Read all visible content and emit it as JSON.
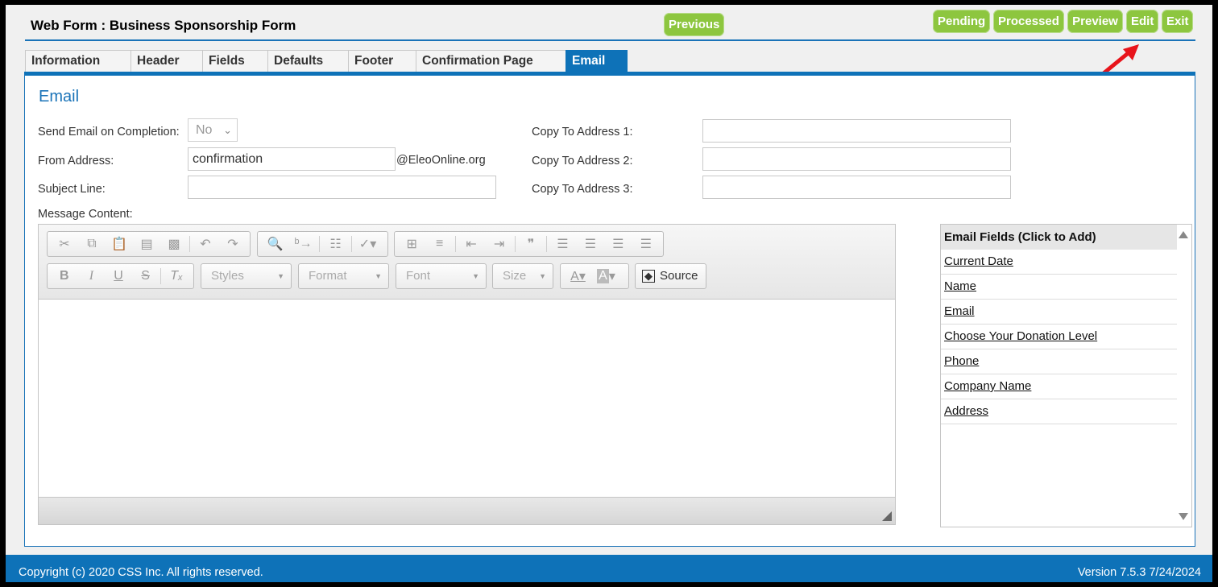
{
  "header": {
    "title": "Web Form : Business Sponsorship Form"
  },
  "nav_buttons": {
    "previous": "Previous",
    "pending": "Pending",
    "processed": "Processed",
    "preview": "Preview",
    "edit": "Edit",
    "exit": "Exit"
  },
  "tabs": [
    {
      "label": "Information"
    },
    {
      "label": "Header"
    },
    {
      "label": "Fields"
    },
    {
      "label": "Defaults"
    },
    {
      "label": "Footer"
    },
    {
      "label": "Confirmation Page"
    },
    {
      "label": "Email",
      "active": true
    }
  ],
  "email": {
    "section_title": "Email",
    "send_label": "Send Email on Completion:",
    "send_value": "No",
    "from_label": "From Address:",
    "from_value": "confirmation",
    "from_domain": "@EleoOnline.org",
    "subject_label": "Subject Line:",
    "subject_value": "",
    "copy1_label": "Copy To Address 1:",
    "copy2_label": "Copy To Address 2:",
    "copy3_label": "Copy To Address 3:",
    "message_label": "Message Content:"
  },
  "editor": {
    "styles": "Styles",
    "format": "Format",
    "font": "Font",
    "size": "Size",
    "source": "Source"
  },
  "fields_panel": {
    "title": "Email Fields (Click to Add)",
    "items": [
      "Current Date",
      "Name",
      "Email",
      "Choose Your Donation Level",
      "Phone",
      "Company Name",
      "Address"
    ]
  },
  "footer": {
    "copyright": "Copyright (c) 2020 CSS Inc. All rights reserved.",
    "version": "Version 7.5.3 7/24/2024"
  },
  "colors": {
    "accent": "#0e72b8",
    "button_green": "#8dc63f",
    "annotation_arrow": "#e8141b"
  }
}
